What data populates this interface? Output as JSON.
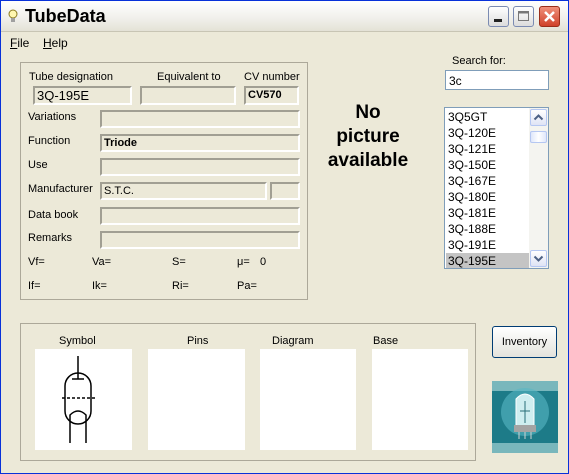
{
  "window": {
    "title": "TubeData"
  },
  "menu": [
    {
      "label": "File",
      "mnemonic": "F",
      "rest": "ile"
    },
    {
      "label": "Help",
      "mnemonic": "H",
      "rest": "elp"
    }
  ],
  "details": {
    "headers": {
      "designation": "Tube designation",
      "equivalent": "Equivalent to",
      "cv": "CV number"
    },
    "designation": "3Q-195E",
    "equivalent": "",
    "cv_number": "CV570",
    "rows": [
      {
        "label": "Variations",
        "value": ""
      },
      {
        "label": "Function",
        "value": "Triode"
      },
      {
        "label": "Use",
        "value": ""
      },
      {
        "label": "Manufacturer",
        "value": "S.T.C."
      },
      {
        "label": "Data book",
        "value": ""
      },
      {
        "label": "Remarks",
        "value": ""
      }
    ],
    "params": [
      {
        "label": "Vf=",
        "value": ""
      },
      {
        "label": "Va=",
        "value": ""
      },
      {
        "label": "S=",
        "value": ""
      },
      {
        "label": "μ=",
        "value": "0"
      },
      {
        "label": "If=",
        "value": ""
      },
      {
        "label": "Ik=",
        "value": ""
      },
      {
        "label": "Ri=",
        "value": ""
      },
      {
        "label": "Pa=",
        "value": ""
      }
    ]
  },
  "picture": {
    "placeholder_line1": "No",
    "placeholder_line2": "picture",
    "placeholder_line3": "available"
  },
  "search": {
    "label": "Search for:",
    "value": "3c"
  },
  "results": {
    "items": [
      "3Q5GT",
      "3Q-120E",
      "3Q-121E",
      "3Q-150E",
      "3Q-167E",
      "3Q-180E",
      "3Q-181E",
      "3Q-188E",
      "3Q-191E",
      "3Q-195E"
    ],
    "selected": "3Q-195E"
  },
  "tabs": [
    {
      "label": "Symbol"
    },
    {
      "label": "Pins"
    },
    {
      "label": "Diagram"
    },
    {
      "label": "Base"
    }
  ],
  "buttons": {
    "inventory": "Inventory"
  },
  "icons": [
    "lightbulb-icon",
    "minimize-icon",
    "maximize-icon",
    "close-icon",
    "scroll-up-icon",
    "scroll-down-icon",
    "triode-symbol-icon",
    "tube-logo-icon"
  ]
}
